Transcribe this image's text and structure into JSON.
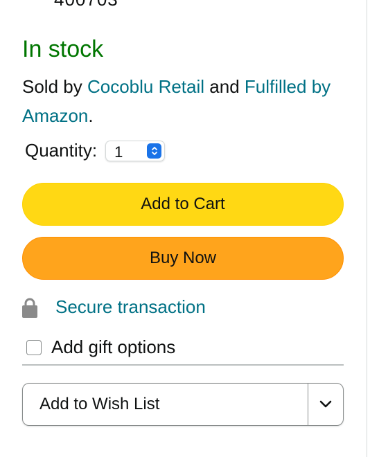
{
  "availability": {
    "top_partial_text": "400703",
    "stock_status": "In stock",
    "stock_color": "#007600"
  },
  "seller": {
    "prefix": "Sold by ",
    "seller_name": "Cocoblu Retail",
    "connector": " and ",
    "fulfillment": "Fulfilled by Amazon",
    "suffix": "."
  },
  "quantity": {
    "label": "Quantity:",
    "value": "1",
    "icon": "stepper-arrows-icon"
  },
  "buttons": {
    "add_to_cart": "Add to Cart",
    "buy_now": "Buy Now",
    "cart_color": "#ffd814",
    "buy_color": "#ffa41c"
  },
  "secure": {
    "icon": "lock-icon",
    "label": "Secure transaction",
    "link_color": "#007185"
  },
  "gift": {
    "label": "Add gift options",
    "checked": false
  },
  "wishlist": {
    "label": "Add to Wish List",
    "dropdown_icon": "chevron-down-icon"
  }
}
